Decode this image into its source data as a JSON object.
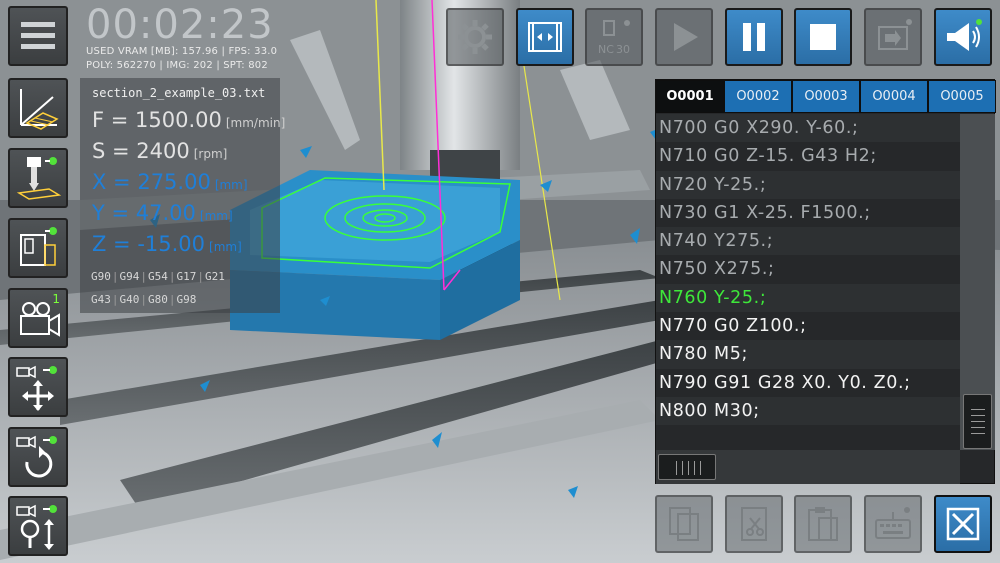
{
  "hud": {
    "timer": "00:02:23",
    "stats_line1": "USED VRAM [MB]: 157.96  |  FPS: 33.0",
    "stats_line2": "POLY: 562270  |  IMG: 202  |  SPT: 802",
    "filename": "section_2_example_03.txt",
    "feed": {
      "label": "F = 1500.00",
      "unit": "[mm/min]"
    },
    "spindle": {
      "label": "S = 2400",
      "unit": "[rpm]"
    },
    "x": {
      "label": "X = 275.00",
      "unit": "[mm]"
    },
    "y": {
      "label": "Y = 47.00",
      "unit": "[mm]"
    },
    "z": {
      "label": "Z = -15.00",
      "unit": "[mm]"
    },
    "gcodes_row1": [
      "G90",
      "G94",
      "G54",
      "G17",
      "G21"
    ],
    "gcodes_row2": [
      "G43",
      "G40",
      "G80",
      "G98"
    ]
  },
  "left_toolbar": {
    "camera_badge": "1",
    "icons": [
      "toolpath-graph-icon",
      "tool-setup-icon",
      "machine-view-icon",
      "camera-icon",
      "camera-pan-icon",
      "camera-rotate-icon",
      "camera-zoom-icon"
    ]
  },
  "top_toolbar": {
    "nc_label": "NC",
    "nc_sub": "30",
    "icons": [
      "settings-icon",
      "split-view-icon",
      "nc-tool-icon",
      "play-icon",
      "pause-icon",
      "stop-icon",
      "export-icon",
      "sound-icon"
    ]
  },
  "program": {
    "tabs": [
      "O0001",
      "O0002",
      "O0003",
      "O0004",
      "O0005"
    ],
    "active_tab": "O0001",
    "lines": [
      {
        "text": "N700  G0  X290.  Y-60.;",
        "state": "dim"
      },
      {
        "text": "N710  G0  Z-15.  G43  H2;",
        "state": "dim"
      },
      {
        "text": "N720  Y-25.;",
        "state": "dim"
      },
      {
        "text": "N730  G1  X-25.  F1500.;",
        "state": "dim"
      },
      {
        "text": "N740  Y275.;",
        "state": "dim"
      },
      {
        "text": "N750  X275.;",
        "state": "dim"
      },
      {
        "text": "N760  Y-25.;",
        "state": "cur"
      },
      {
        "text": "N770  G0  Z100.;",
        "state": "normal"
      },
      {
        "text": "N780  M5;",
        "state": "normal"
      },
      {
        "text": "N790  G91  G28  X0.  Y0.  Z0.;",
        "state": "normal"
      },
      {
        "text": "N800  M30;",
        "state": "normal"
      },
      {
        "text": "",
        "state": "normal"
      }
    ]
  },
  "bottom_toolbar": {
    "icons": [
      "copy-icon",
      "cut-icon",
      "paste-icon",
      "keyboard-icon",
      "close-icon"
    ]
  },
  "colors": {
    "accent_blue": "#2f7fc1",
    "current_line_green": "#3ee83a",
    "workpiece_blue": "#2a8fc9",
    "toolpath_green": "#39ff3a",
    "axis_yellow": "#e8e84a",
    "axis_magenta": "#ff2fd6"
  }
}
